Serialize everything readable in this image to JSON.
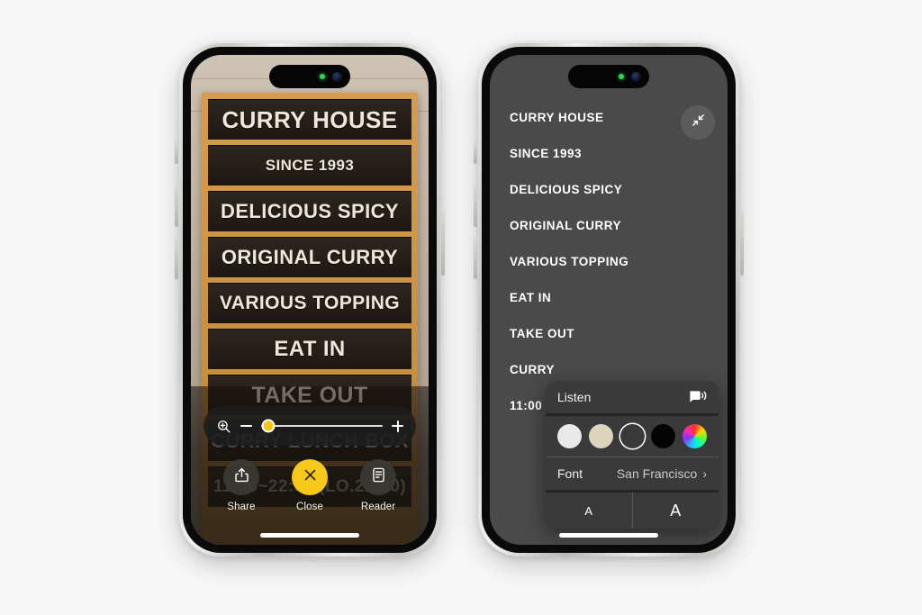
{
  "background_color": "#f7f7f7",
  "left_phone": {
    "name": "visual-lookup-photo-view",
    "status": {
      "recording_indicator": "green-dot"
    },
    "sign": {
      "rows": [
        "CURRY HOUSE",
        "SINCE 1993",
        "DELICIOUS SPICY",
        "ORIGINAL CURRY",
        "VARIOUS TOPPING",
        "EAT IN",
        "TAKE OUT",
        "CURRY LUNCH BOX",
        "11:00~22:30 (LO.22:00)"
      ]
    },
    "zoom_control": {
      "magnifier_icon": "zoom-in-magnifier-icon",
      "minus_label": "−",
      "plus_label": "+",
      "value_percent": 6,
      "thumb_color": "#f5c518"
    },
    "actions": [
      {
        "label": "Share",
        "icon": "share-icon",
        "highlight": false
      },
      {
        "label": "Close",
        "icon": "close-icon",
        "highlight": true
      },
      {
        "label": "Reader",
        "icon": "reader-icon",
        "highlight": false
      }
    ],
    "accent_color": "#f6c81a"
  },
  "right_phone": {
    "name": "reader-view",
    "collapse_icon": "collapse-arrows-icon",
    "text_size_button": {
      "small": "a",
      "big": "A",
      "icon": "text-size-icon"
    },
    "lines": [
      "CURRY HOUSE",
      "SINCE 1993",
      "DELICIOUS SPICY",
      "ORIGINAL CURRY",
      "VARIOUS TOPPING",
      "EAT IN",
      "TAKE OUT",
      "CURRY",
      "11:00"
    ],
    "popover": {
      "listen_label": "Listen",
      "listen_icon": "speaker-wave-icon",
      "themes": [
        {
          "name": "white",
          "color": "#e9e9e9",
          "selected": false
        },
        {
          "name": "sepia",
          "color": "#ded3bd",
          "selected": false
        },
        {
          "name": "gray",
          "color": "#3a3a3a",
          "selected": true
        },
        {
          "name": "black",
          "color": "#040404",
          "selected": false
        },
        {
          "name": "color-wheel",
          "color": "wheel",
          "selected": false
        }
      ],
      "font_label": "Font",
      "font_value": "San Francisco",
      "chevron_icon": "chevron-right-icon",
      "size_decrease_label": "A",
      "size_increase_label": "A"
    }
  }
}
